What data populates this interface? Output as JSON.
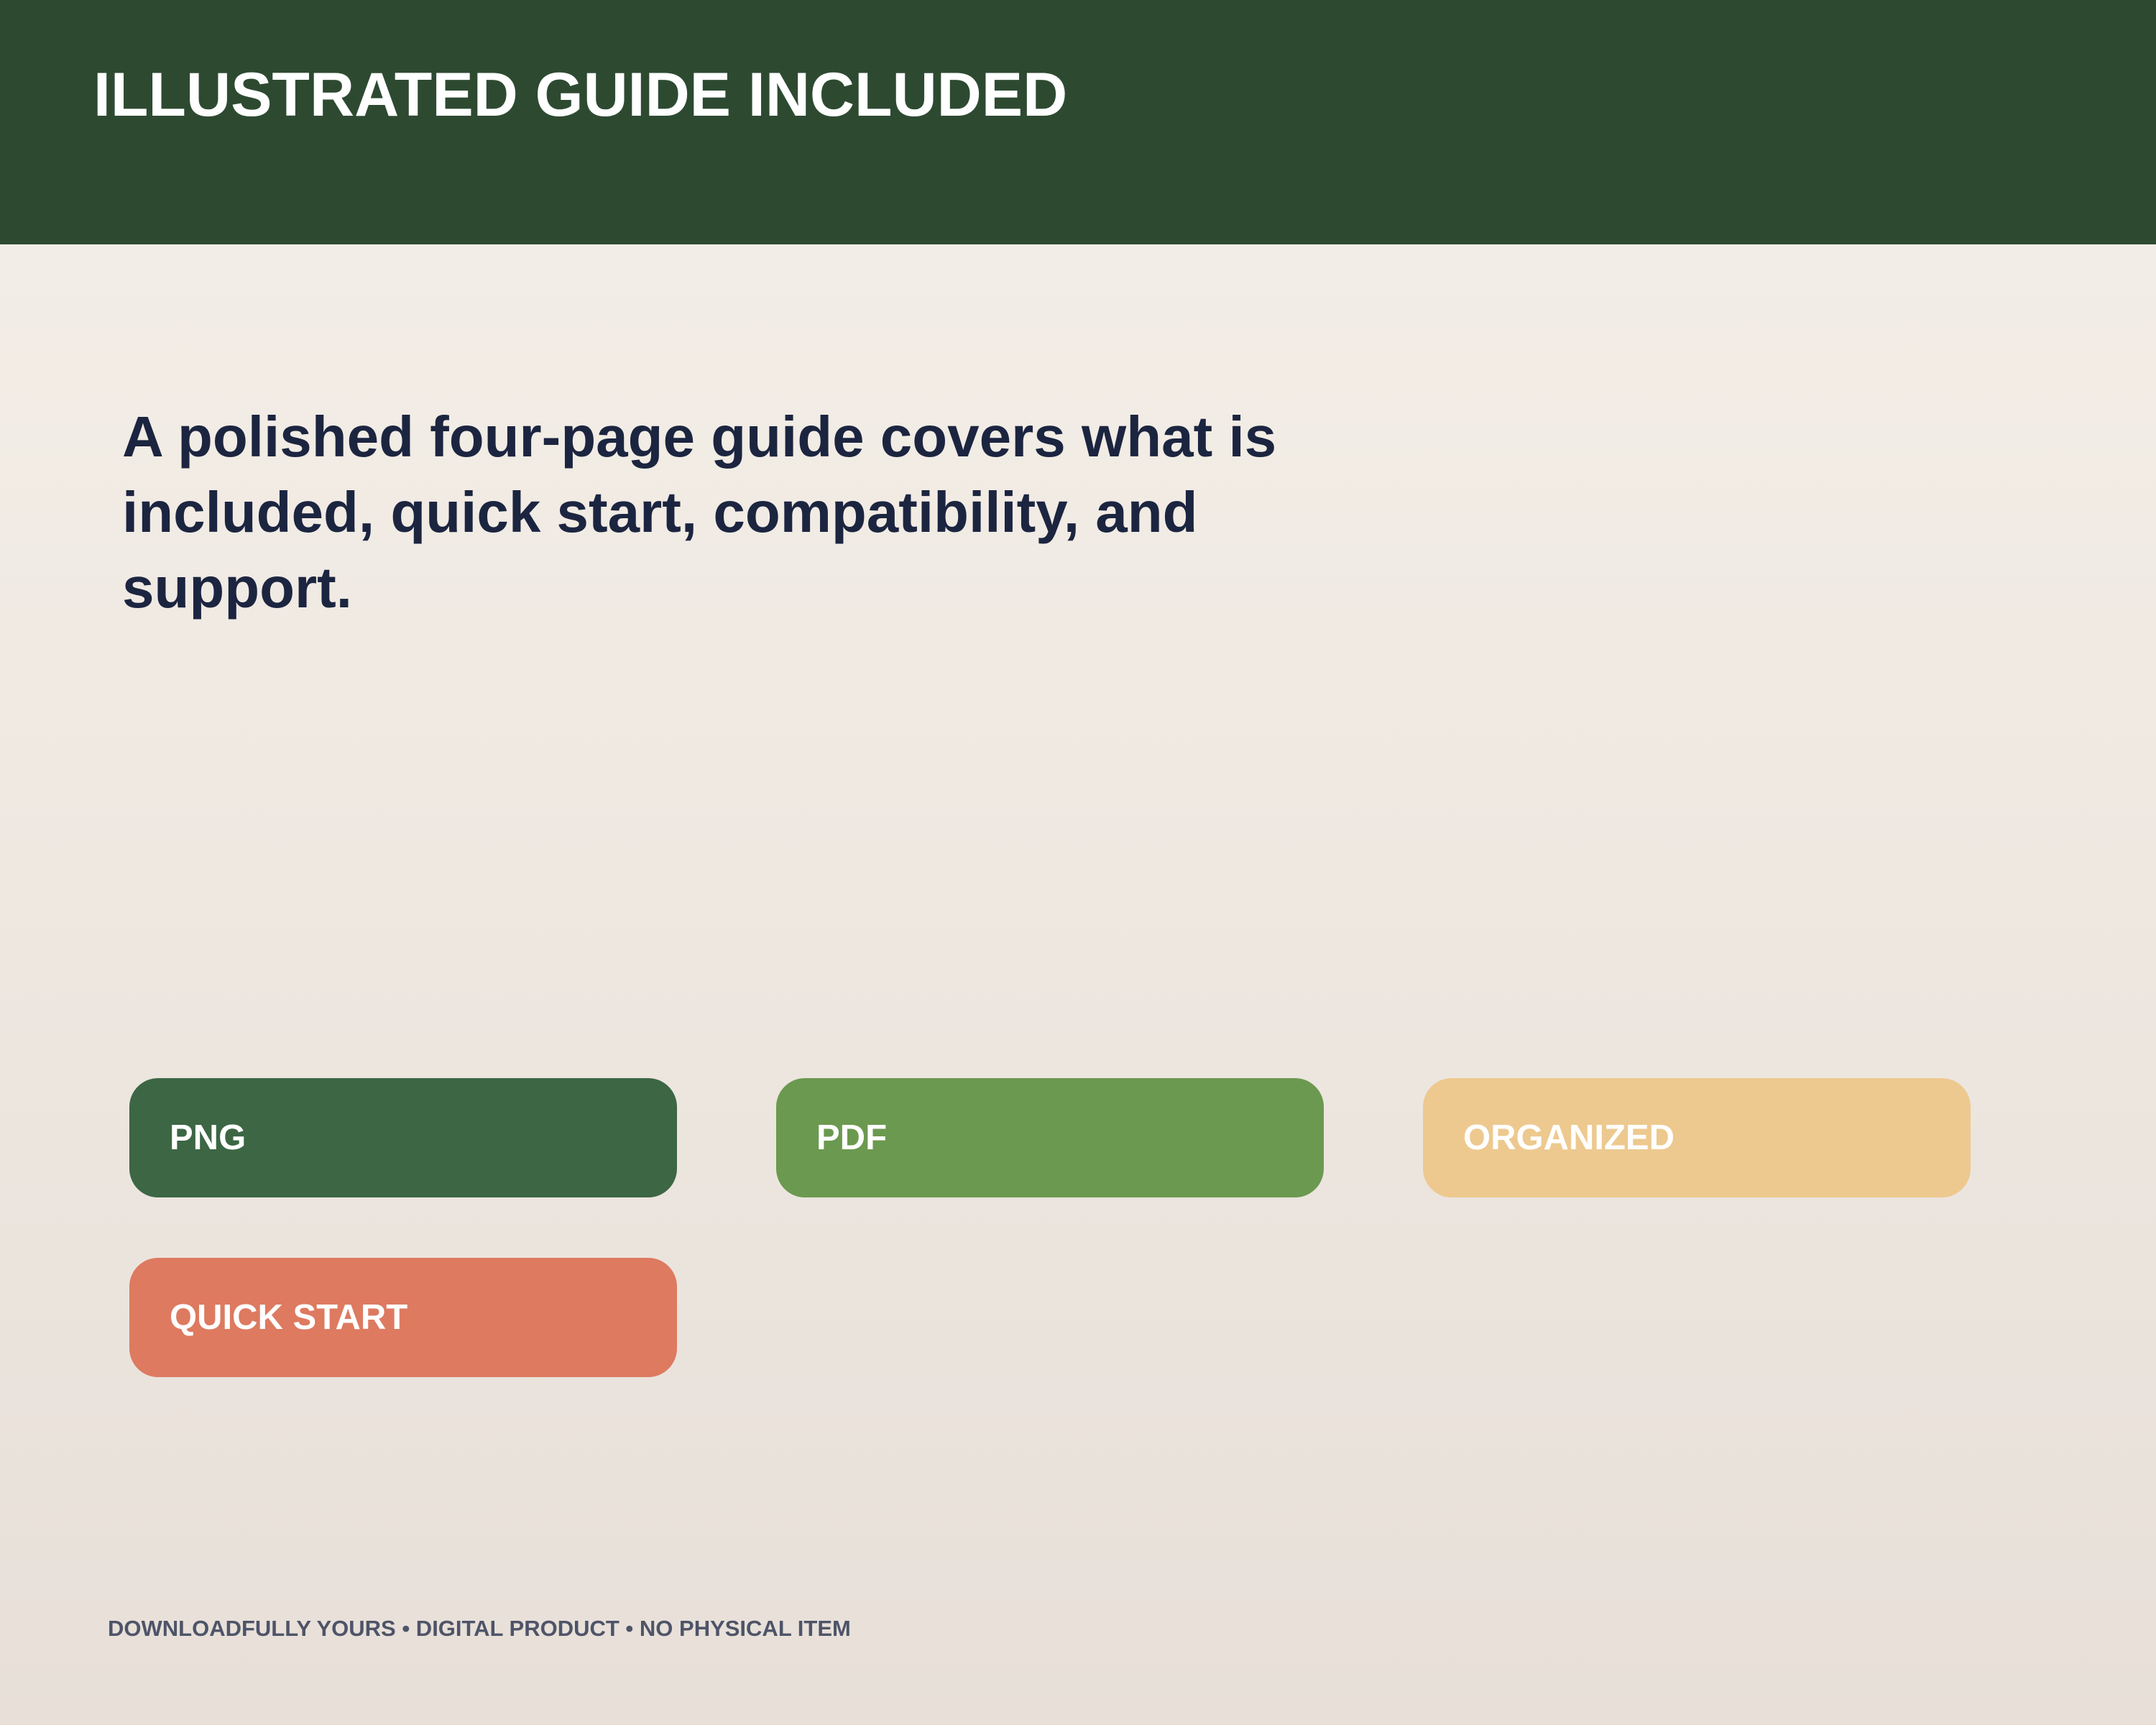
{
  "header": {
    "title": "ILLUSTRATED GUIDE INCLUDED"
  },
  "main": {
    "description": "A polished four-page guide covers what is included, quick start, compatibility, and support."
  },
  "tags": [
    {
      "label": "PNG",
      "color": "#3c6644"
    },
    {
      "label": "PDF",
      "color": "#6b994f"
    },
    {
      "label": "ORGANIZED",
      "color": "#edc98f"
    },
    {
      "label": "QUICK START",
      "color": "#dd7a60"
    }
  ],
  "footer": {
    "text": "DOWNLOADFULLY YOURS • DIGITAL PRODUCT • NO PHYSICAL ITEM"
  },
  "colors": {
    "header_bg": "#2d4a31",
    "heading_text": "#1c2540",
    "footer_text": "#4e5468"
  }
}
